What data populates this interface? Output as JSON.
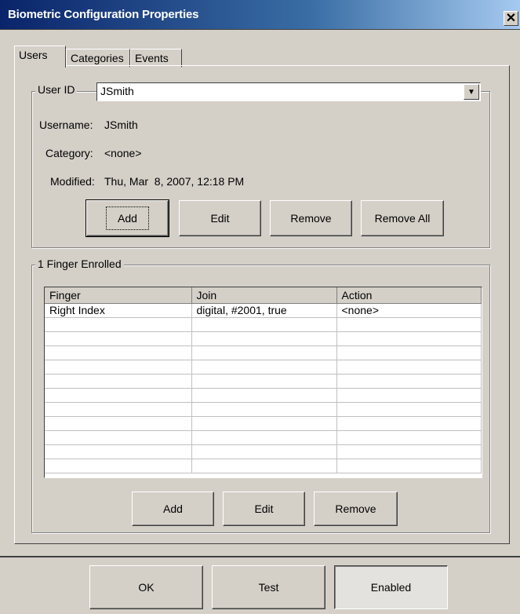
{
  "window": {
    "title": "Biometric Configuration Properties",
    "close_symbol": "✕"
  },
  "tabs": [
    {
      "label": "Users",
      "active": true
    },
    {
      "label": "Categories",
      "active": false
    },
    {
      "label": "Events",
      "active": false
    }
  ],
  "user_group": {
    "label": "User ID",
    "user_id_value": "JSmith",
    "username_label": "Username:",
    "username_value": "JSmith",
    "category_label": "Category:",
    "category_value": "<none>",
    "modified_label": "Modified:",
    "modified_value": "Thu, Mar  8, 2007, 12:18 PM",
    "buttons": {
      "add": "Add",
      "edit": "Edit",
      "remove": "Remove",
      "remove_all": "Remove All"
    }
  },
  "finger_group": {
    "label": "1 Finger Enrolled",
    "columns": [
      "Finger",
      "Join",
      "Action"
    ],
    "rows": [
      [
        "Right Index",
        "digital, #2001, true",
        "<none>"
      ]
    ],
    "buttons": {
      "add": "Add",
      "edit": "Edit",
      "remove": "Remove"
    }
  },
  "footer": {
    "ok": "OK",
    "test": "Test",
    "enabled": "Enabled"
  },
  "colors": {
    "face": "#d4d0c8",
    "title_start": "#0a246a",
    "title_end": "#a6caf0"
  }
}
